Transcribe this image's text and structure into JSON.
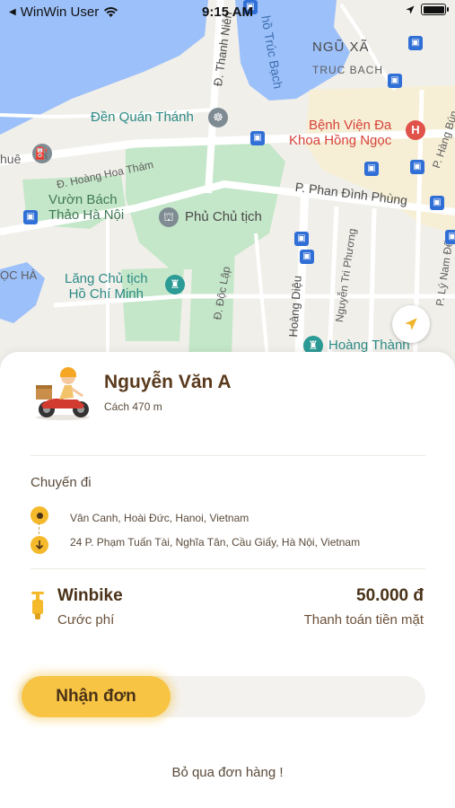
{
  "status_bar": {
    "carrier": "WinWin User",
    "time": "9:15 AM",
    "battery_level": 1.0
  },
  "map": {
    "labels": {
      "truc_bach_lake": "hồ Trúc Bạch",
      "thanh_nien": "Đ. Thanh Niên",
      "ngu_xa": "NGŨ XÃ",
      "truc_bach": "TRUC BACH",
      "quan_thanh": "Đền Quán Thánh",
      "hospital": "Bệnh Viện Đa\nKhoa Hồng Ngọc",
      "hue": "huê",
      "hoang_hoa_tham": "Đ. Hoàng Hoa Thám",
      "botanical": "Vườn Bách\nThảo Hà Nội",
      "presidential": "Phủ Chủ tịch",
      "phan_dinh_phung": "P. Phan Đình Phùng",
      "hang_bun": "P. Hàng Bún",
      "oc_ha": "ỌC HÀ",
      "mausoleum": "Lăng Chủ tịch\nHồ Chí Minh",
      "doc_lap": "Đ. Độc Lập",
      "hoang_dieu": "Hoàng Diệu",
      "nguyen_tri_phuong": "Nguyễn Tri Phương",
      "ly_nam_de": "P. Lý Nam Đế",
      "hoang_thanh": "Hoàng Thành"
    }
  },
  "driver": {
    "name": "Nguyễn Văn A",
    "distance": "Cách 470 m"
  },
  "trip": {
    "label": "Chuyến đi",
    "pickup": "Vân Canh, Hoài Đức, Hanoi, Vietnam",
    "dropoff": "24 P. Phạm Tuấn Tài, Nghĩa Tân, Cầu Giấy, Hà Nội, Vietnam"
  },
  "service": {
    "name": "Winbike",
    "fee_label": "Cước phí",
    "price": "50.000 đ",
    "payment_method": "Thanh toán tiền mặt"
  },
  "actions": {
    "accept": "Nhận đơn",
    "skip": "Bỏ qua đơn hàng !"
  },
  "colors": {
    "accent": "#f7c443",
    "text_brown": "#4a3218",
    "water": "#9cc0f9",
    "park": "#c5e7c9"
  }
}
